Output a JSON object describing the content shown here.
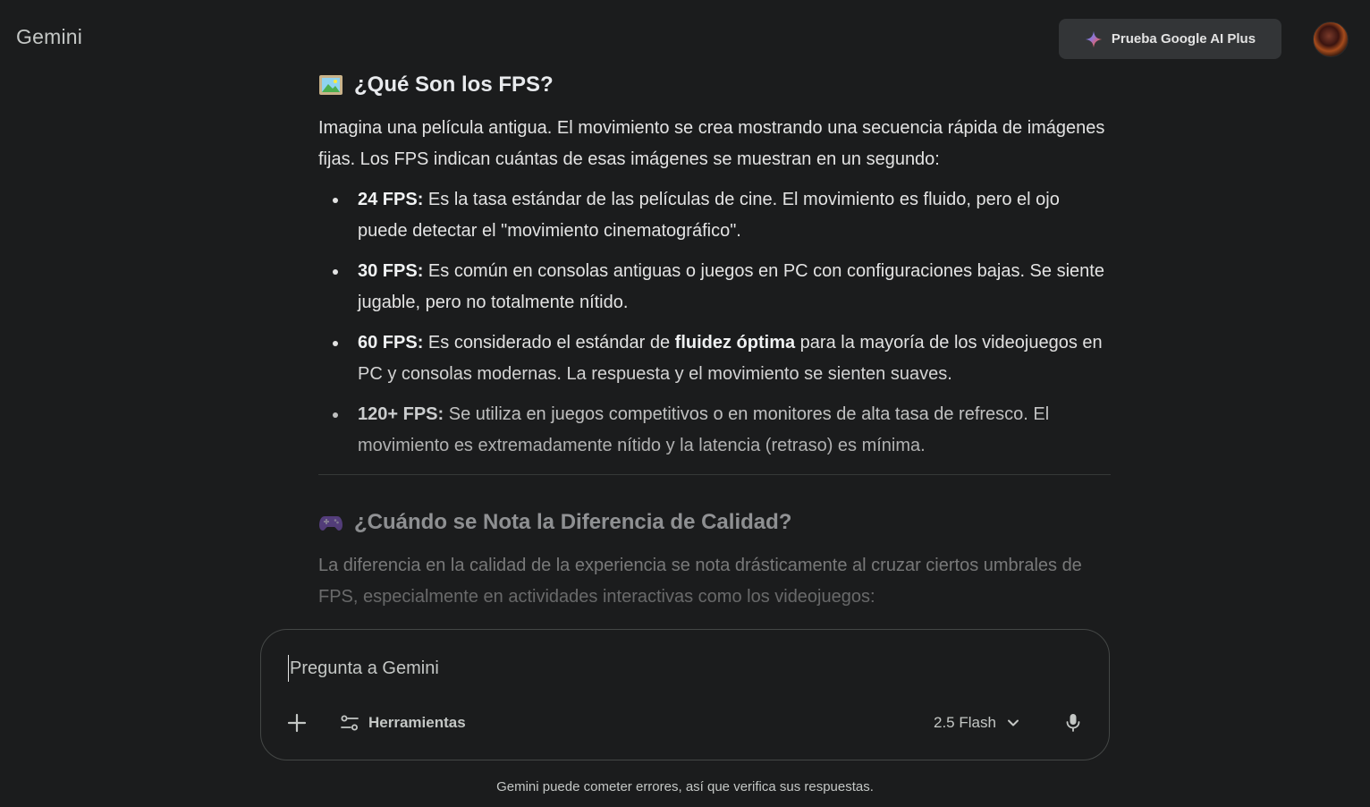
{
  "header": {
    "brand": "Gemini",
    "upgrade_label": "Prueba Google AI Plus"
  },
  "response": {
    "section1": {
      "title": "¿Qué Son los FPS?",
      "intro": "Imagina una película antigua. El movimiento se crea mostrando una secuencia rápida de imágenes fijas. Los FPS indican cuántas de esas imágenes se muestran en un segundo:",
      "bullets": [
        {
          "bold": "24 FPS:",
          "text": " Es la tasa estándar de las películas de cine. El movimiento es fluido, pero el ojo puede detectar el \"movimiento cinematográfico\"."
        },
        {
          "bold": "30 FPS:",
          "text": " Es común en consolas antiguas o juegos en PC con configuraciones bajas. Se siente jugable, pero no totalmente nítido."
        },
        {
          "bold": "60 FPS:",
          "text_before": " Es considerado el estándar de ",
          "bold_inline": "fluidez óptima",
          "text_after": " para la mayoría de los videojuegos en PC y consolas modernas. La respuesta y el movimiento se sienten suaves."
        },
        {
          "bold": "120+ FPS:",
          "text": " Se utiliza en juegos competitivos o en monitores de alta tasa de refresco. El movimiento es extremadamente nítido y la latencia (retraso) es mínima."
        }
      ]
    },
    "section2": {
      "title": "¿Cuándo se Nota la Diferencia de Calidad?",
      "intro": "La diferencia en la calidad de la experiencia se nota drásticamente al cruzar ciertos umbrales de FPS, especialmente en actividades interactivas como los videojuegos:"
    }
  },
  "composer": {
    "placeholder": "Pregunta a Gemini",
    "value": "",
    "tools_label": "Herramientas",
    "model_label": "2.5 Flash"
  },
  "footer": {
    "disclaimer": "Gemini puede cometer errores, así que verifica sus respuestas."
  },
  "icons": {
    "section1": "framed-picture-icon",
    "section2": "game-controller-icon",
    "upgrade": "sparkle-icon",
    "add": "plus-icon",
    "tools": "tune-icon",
    "model": "chevron-down-icon",
    "mic": "microphone-icon"
  }
}
